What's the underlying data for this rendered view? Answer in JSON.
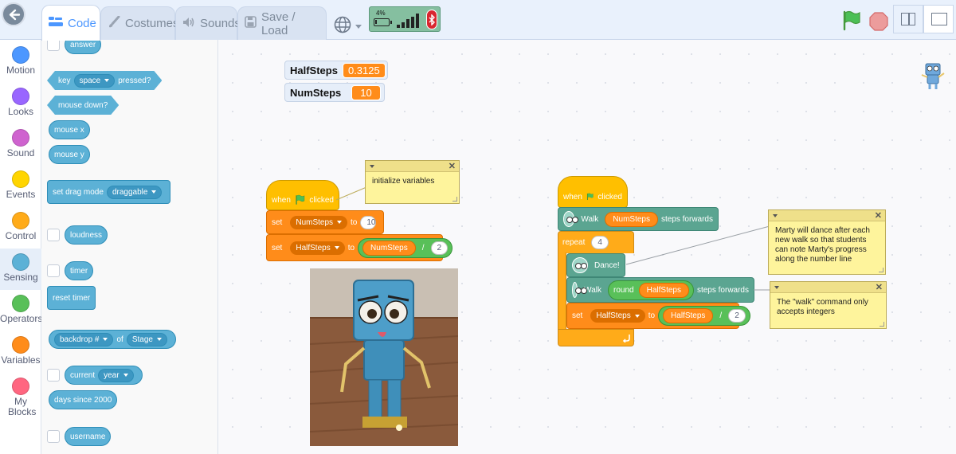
{
  "tabs": {
    "code": "Code",
    "costumes": "Costumes",
    "sounds": "Sounds",
    "save": "Save / Load"
  },
  "device": {
    "battery_text": "4%",
    "battery_fraction": 0.04,
    "signal_bars": 5
  },
  "categories": [
    {
      "label": "Motion",
      "color": "#4c97ff"
    },
    {
      "label": "Looks",
      "color": "#9966ff"
    },
    {
      "label": "Sound",
      "color": "#cf63cf"
    },
    {
      "label": "Events",
      "color": "#ffd500"
    },
    {
      "label": "Control",
      "color": "#ffab19"
    },
    {
      "label": "Sensing",
      "color": "#5cb1d6"
    },
    {
      "label": "Operators",
      "color": "#59c059"
    },
    {
      "label": "Variables",
      "color": "#ff8c1a"
    },
    {
      "label": "My Blocks",
      "color": "#ff6680"
    }
  ],
  "palette": {
    "answer": "answer",
    "key": "key",
    "key_option": "space",
    "pressed": "pressed?",
    "mouse_down": "mouse down?",
    "mouse_x": "mouse x",
    "mouse_y": "mouse y",
    "set_drag_mode": "set drag mode",
    "drag_option": "draggable",
    "loudness": "loudness",
    "timer": "timer",
    "reset_timer": "reset timer",
    "backdrop_option": "backdrop #",
    "of": "of",
    "stage_option": "Stage",
    "current": "current",
    "current_option": "year",
    "days_since": "days since 2000",
    "username": "username"
  },
  "monitors": [
    {
      "name": "HalfSteps",
      "value": "0.3125"
    },
    {
      "name": "NumSteps",
      "value": "10"
    }
  ],
  "script1": {
    "when": "when",
    "clicked": "clicked",
    "set": "set",
    "to": "to",
    "var1": "NumSteps",
    "val1": "10",
    "var2": "HalfSteps",
    "op_var": "NumSteps",
    "op_sym": "/",
    "op_val": "2"
  },
  "script2": {
    "when": "when",
    "clicked": "clicked",
    "walk": "Walk",
    "walk_var": "NumSteps",
    "steps_forwards": "steps forwards",
    "repeat": "repeat",
    "repeat_count": "4",
    "dance": "Dance!",
    "round": "round",
    "round_var": "HalfSteps",
    "set": "set",
    "set_var": "HalfSteps",
    "to": "to",
    "op_var": "HalfSteps",
    "op_sym": "/",
    "op_val": "2"
  },
  "comments": {
    "c1": "initialize variables",
    "c2": "Marty will dance after each new walk so that students can note Marty's progress along the number line",
    "c3": "The \"walk\" command only accepts integers"
  }
}
